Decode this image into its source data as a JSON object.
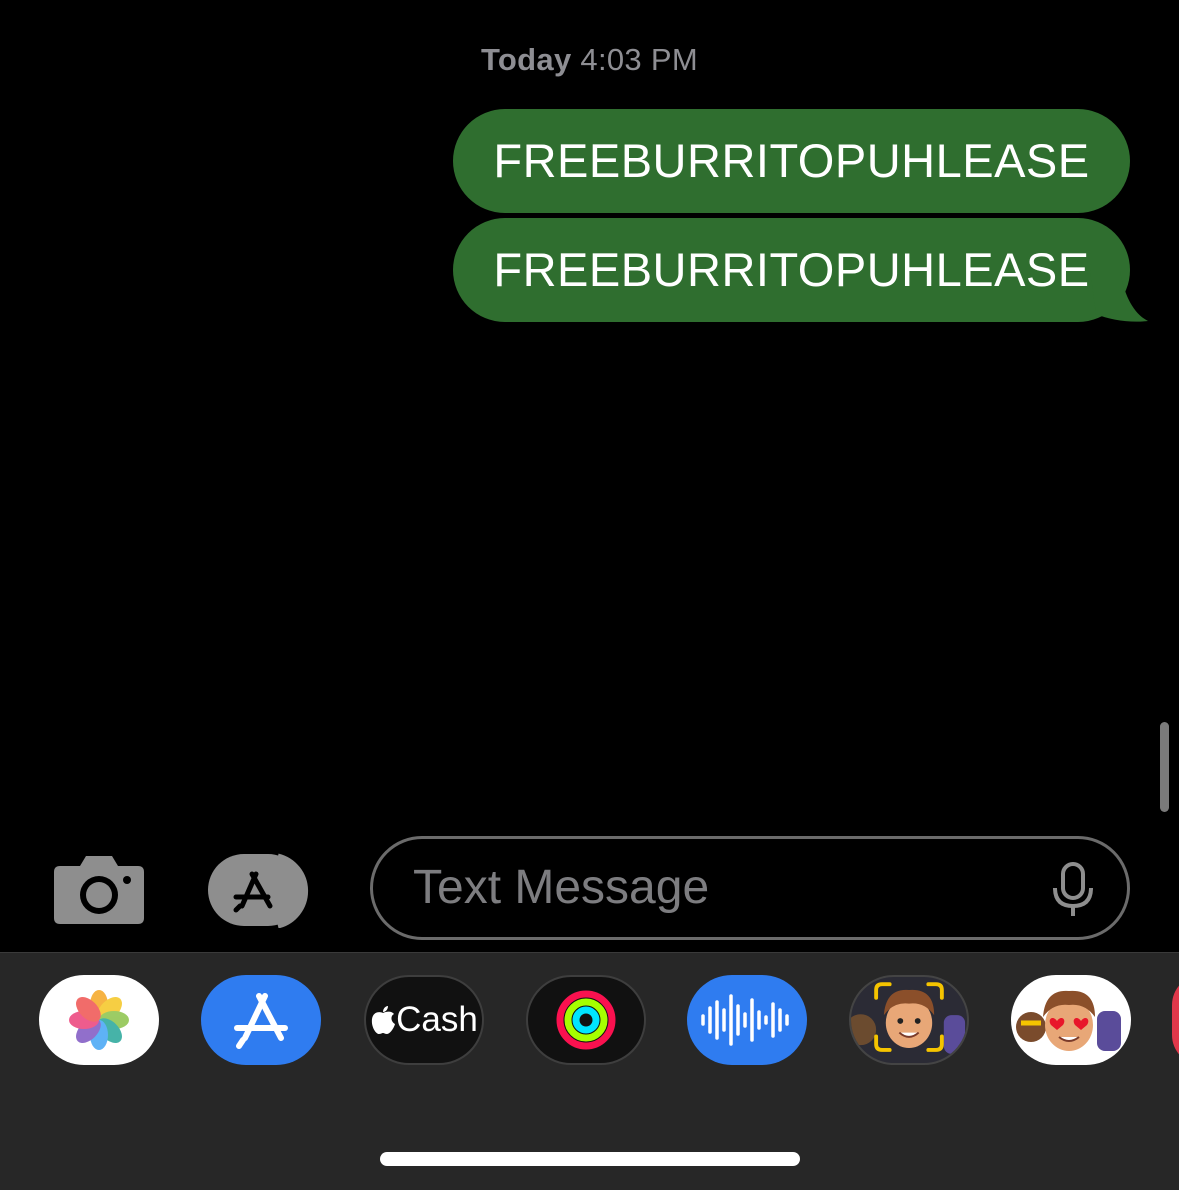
{
  "conversation": {
    "timestamp_day": "Today",
    "timestamp_time": "4:03 PM",
    "messages": [
      {
        "text": "FREEBURRITOPUHLEASE",
        "sender": "me"
      },
      {
        "text": "FREEBURRITOPUHLEASE",
        "sender": "me"
      }
    ]
  },
  "composer": {
    "placeholder": "Text Message",
    "camera_icon": "camera-icon",
    "apps_icon": "app-store-icon",
    "mic_icon": "microphone-icon"
  },
  "app_tray": {
    "apps": [
      {
        "name": "photos-app",
        "icon": "photos-icon"
      },
      {
        "name": "app-store-app",
        "icon": "app-store-icon"
      },
      {
        "name": "apple-cash-app",
        "icon": "apple-logo-icon",
        "label": "Cash"
      },
      {
        "name": "fitness-app",
        "icon": "activity-rings-icon"
      },
      {
        "name": "audio-message-app",
        "icon": "waveform-icon"
      },
      {
        "name": "memoji-camera-app",
        "icon": "memoji-icon"
      },
      {
        "name": "memoji-stickers-app",
        "icon": "memoji-stickers-icon"
      }
    ]
  },
  "colors": {
    "bubble": "#2f6e2f",
    "background": "#000000",
    "tray": "#272727",
    "app_store_blue": "#2f7cf0"
  }
}
